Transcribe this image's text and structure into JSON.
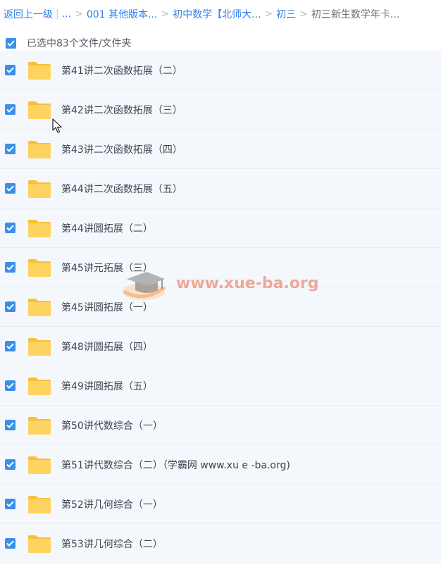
{
  "breadcrumb": {
    "back": "返回上一级",
    "bar": "|",
    "ellipsis": "...",
    "sep": ">",
    "items": [
      "001 其他版本...",
      "初中数学【北师大...",
      "初三"
    ],
    "current": "初三新生数学年卡..."
  },
  "selection": {
    "text": "已选中83个文件/文件夹"
  },
  "files": [
    {
      "name": "第41讲二次函数拓展（二）"
    },
    {
      "name": "第42讲二次函数拓展（三）"
    },
    {
      "name": "第43讲二次函数拓展（四）"
    },
    {
      "name": "第44讲二次函数拓展（五）"
    },
    {
      "name": "第44讲圆拓展（二）"
    },
    {
      "name": "第45讲元拓展（三）"
    },
    {
      "name": "第45讲圆拓展（一）"
    },
    {
      "name": "第48讲圆拓展（四）"
    },
    {
      "name": "第49讲圆拓展（五）"
    },
    {
      "name": "第50讲代数综合（一）"
    },
    {
      "name": "第51讲代数综合（二）（学霸网 www.xu e -ba.org)"
    },
    {
      "name": "第52讲几何综合（一）"
    },
    {
      "name": "第53讲几何综合（二）"
    }
  ],
  "watermark": {
    "text": "www.xue-ba.org"
  },
  "colors": {
    "accent": "#3b8fe8",
    "row_background": "#f4f8fd",
    "folder": "#ffd15c",
    "watermark": "#ec7858"
  },
  "icons": {
    "checkbox": "checkbox-checked-icon",
    "folder": "folder-icon",
    "cursor": "mouse-pointer-icon"
  }
}
